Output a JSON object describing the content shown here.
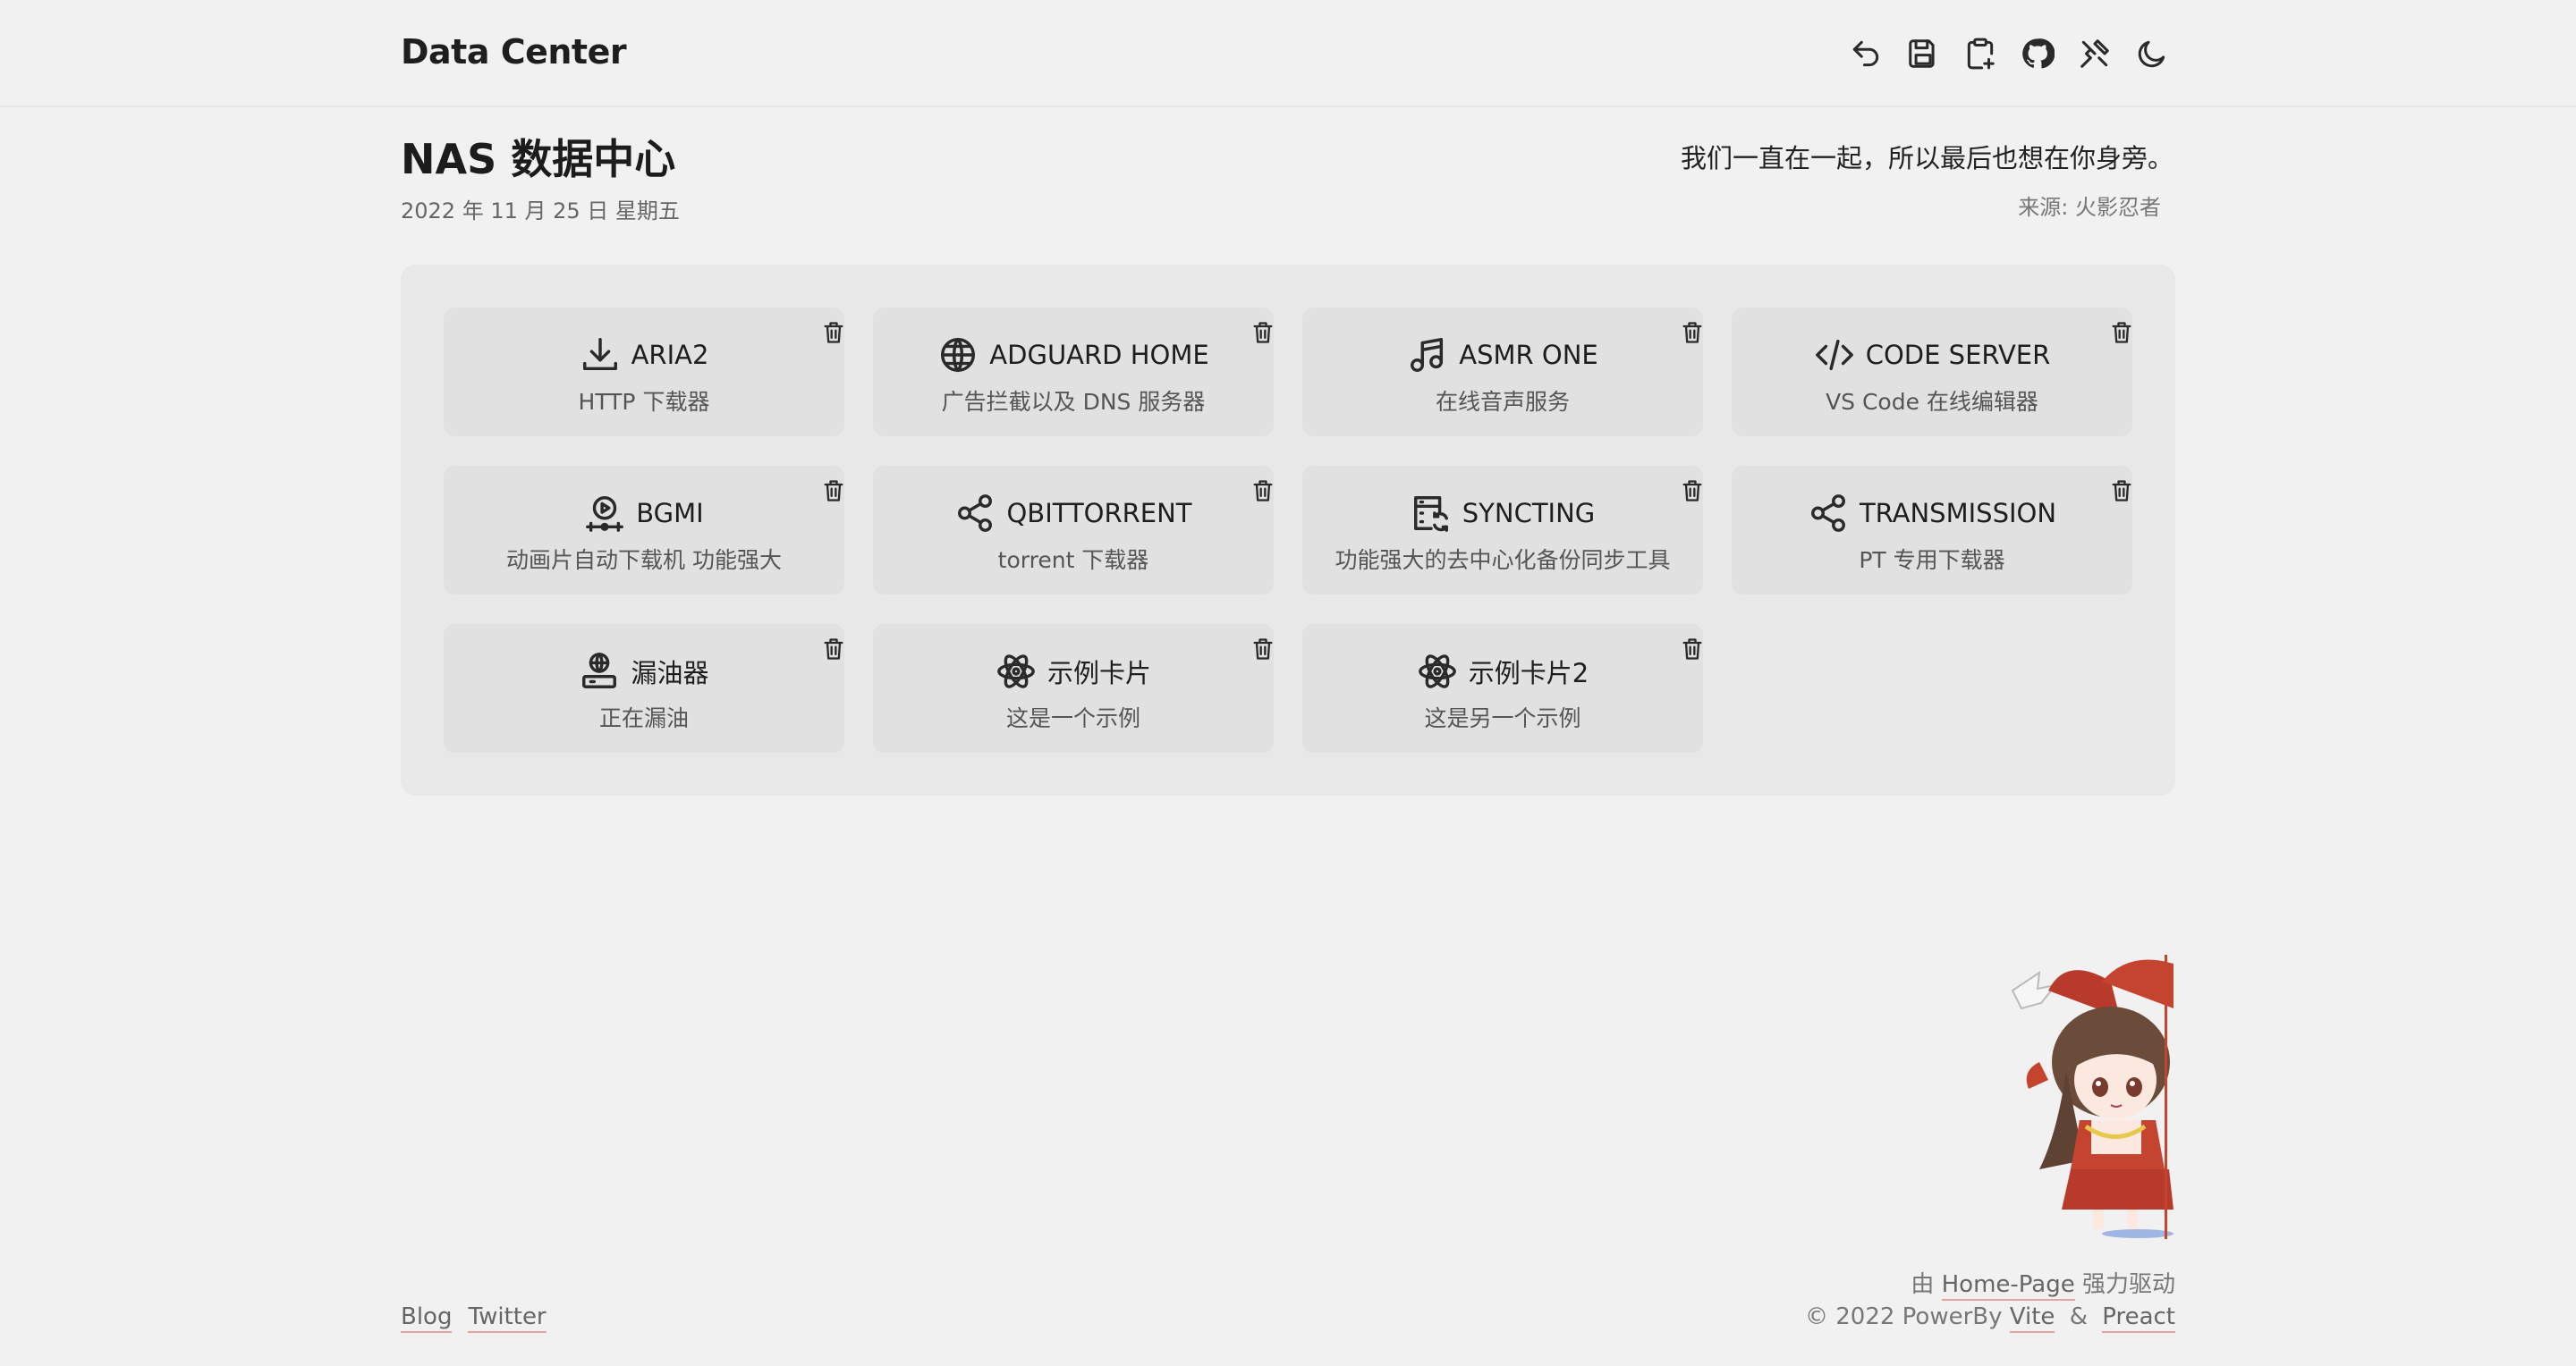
{
  "header": {
    "brand": "Data Center",
    "toolbar_icons": [
      "undo-icon",
      "save-icon",
      "clipboard-plus-icon",
      "github-icon",
      "tools-icon",
      "moon-icon"
    ]
  },
  "page": {
    "title": "NAS 数据中心",
    "date": "2022 年 11 月 25 日 星期五",
    "quote": "我们一直在一起，所以最后也想在你身旁。",
    "quote_source": "来源: 火影忍者"
  },
  "cards": [
    {
      "title": "ARIA2",
      "desc": "HTTP 下载器",
      "icon": "download-icon"
    },
    {
      "title": "ADGUARD HOME",
      "desc": "广告拦截以及 DNS 服务器",
      "icon": "globe-icon"
    },
    {
      "title": "ASMR ONE",
      "desc": "在线音声服务",
      "icon": "music-note-icon"
    },
    {
      "title": "CODE SERVER",
      "desc": "VS Code 在线编辑器",
      "icon": "code-icon"
    },
    {
      "title": "BGMI",
      "desc": "动画片自动下载机 功能强大",
      "icon": "play-timeline-icon"
    },
    {
      "title": "QBITTORRENT",
      "desc": "torrent 下载器",
      "icon": "share-icon"
    },
    {
      "title": "SYNCTING",
      "desc": "功能强大的去中心化备份同步工具",
      "icon": "server-sync-icon"
    },
    {
      "title": "TRANSMISSION",
      "desc": "PT 专用下载器",
      "icon": "share-icon"
    },
    {
      "title": "漏油器",
      "desc": "正在漏油",
      "icon": "web-server-icon"
    },
    {
      "title": "示例卡片",
      "desc": "这是一个示例",
      "icon": "atom-icon"
    },
    {
      "title": "示例卡片2",
      "desc": "这是另一个示例",
      "icon": "atom-icon"
    }
  ],
  "footer": {
    "links": [
      "Blog",
      "Twitter"
    ],
    "powered_prefix": "由",
    "powered_link": "Home-Page",
    "powered_suffix": "强力驱动",
    "copyright": "© 2022 PowerBy",
    "vite": "Vite",
    "amp": "&",
    "preact": "Preact"
  }
}
